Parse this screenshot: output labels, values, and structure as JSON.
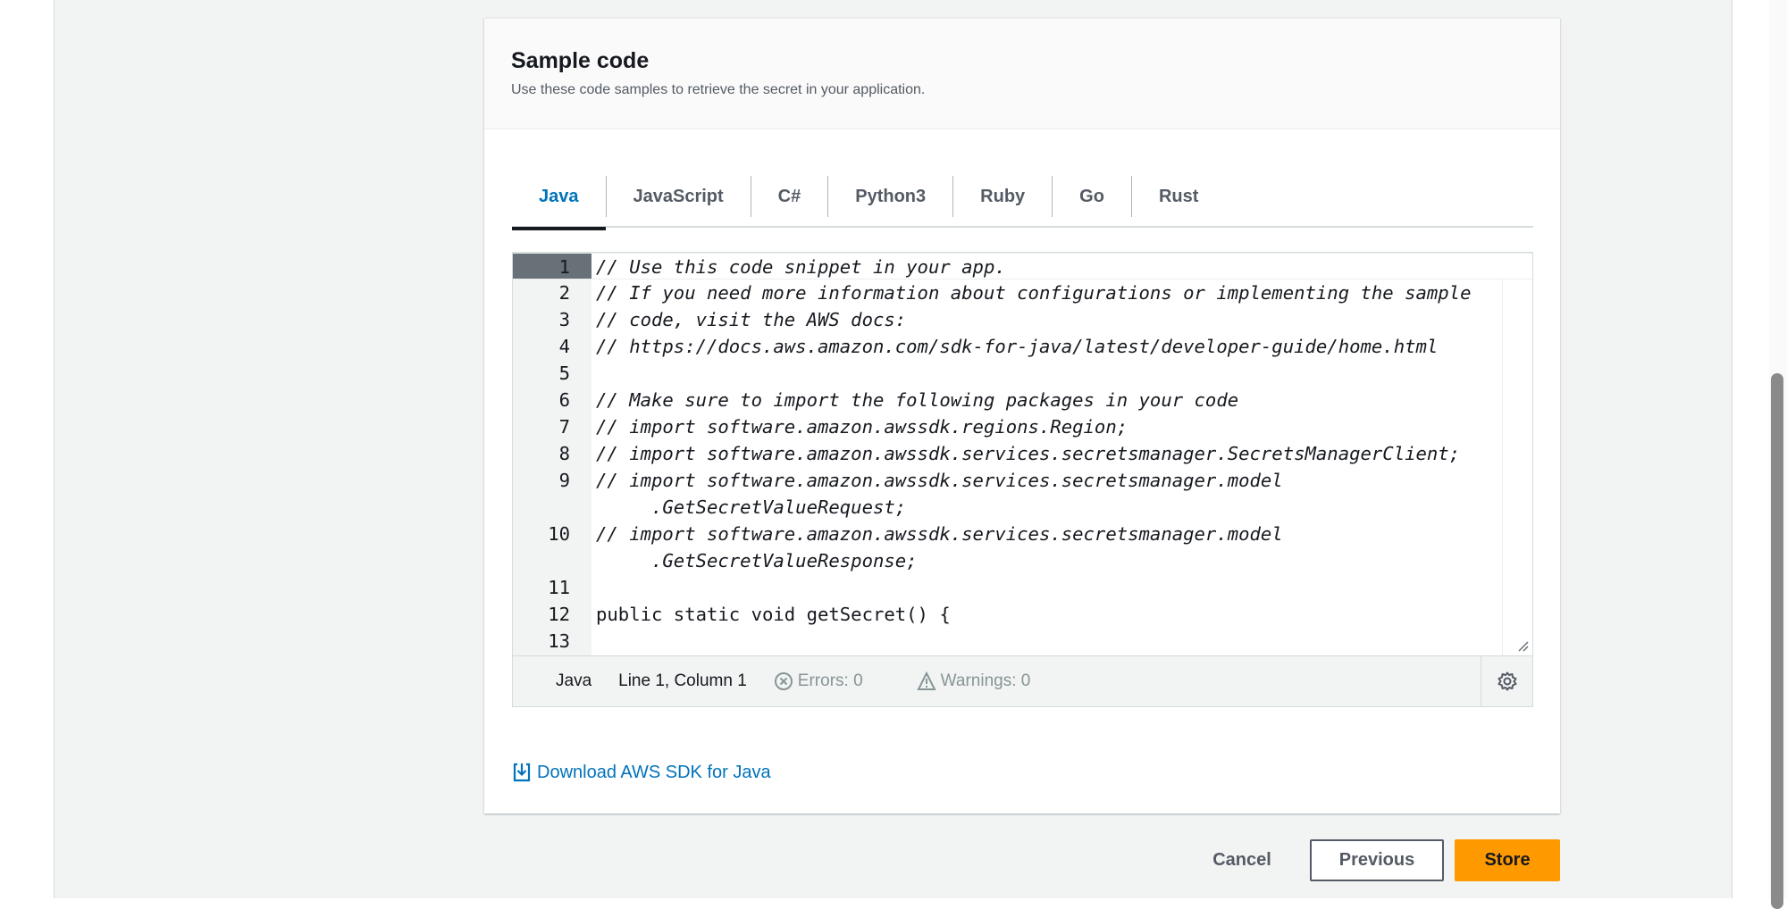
{
  "panel": {
    "title": "Sample code",
    "description": "Use these code samples to retrieve the secret in your application."
  },
  "tabs": [
    {
      "label": "Java",
      "active": true
    },
    {
      "label": "JavaScript"
    },
    {
      "label": "C#"
    },
    {
      "label": "Python3"
    },
    {
      "label": "Ruby"
    },
    {
      "label": "Go"
    },
    {
      "label": "Rust"
    }
  ],
  "editor": {
    "lines": [
      {
        "n": "1",
        "text": "// Use this code snippet in your app.",
        "comment": true
      },
      {
        "n": "2",
        "text": "// If you need more information about configurations or implementing the sample",
        "comment": true
      },
      {
        "n": "3",
        "text": "// code, visit the AWS docs:",
        "comment": true
      },
      {
        "n": "4",
        "text": "// https://docs.aws.amazon.com/sdk-for-java/latest/developer-guide/home.html",
        "comment": true
      },
      {
        "n": "5",
        "text": "",
        "comment": false
      },
      {
        "n": "6",
        "text": "// Make sure to import the following packages in your code",
        "comment": true
      },
      {
        "n": "7",
        "text": "// import software.amazon.awssdk.regions.Region;",
        "comment": true
      },
      {
        "n": "8",
        "text": "// import software.amazon.awssdk.services.secretsmanager.SecretsManagerClient;",
        "comment": true
      },
      {
        "n": "9",
        "text": "// import software.amazon.awssdk.services.secretsmanager.model",
        "comment": true
      },
      {
        "n": "",
        "text": "     .GetSecretValueRequest;",
        "comment": true
      },
      {
        "n": "10",
        "text": "// import software.amazon.awssdk.services.secretsmanager.model",
        "comment": true
      },
      {
        "n": "",
        "text": "     .GetSecretValueResponse;",
        "comment": true
      },
      {
        "n": "11",
        "text": "",
        "comment": false
      },
      {
        "n": "12",
        "text": "public static void getSecret() {",
        "comment": false
      },
      {
        "n": "13",
        "text": "",
        "comment": false
      }
    ],
    "status": {
      "language": "Java",
      "position": "Line 1, Column 1",
      "errors": "Errors: 0",
      "warnings": "Warnings: 0"
    }
  },
  "download_link": "Download AWS SDK for Java",
  "actions": {
    "cancel": "Cancel",
    "previous": "Previous",
    "store": "Store"
  },
  "colors": {
    "accent": "#0073bb",
    "primary_button": "#ff9900",
    "background": "#f2f3f3"
  }
}
